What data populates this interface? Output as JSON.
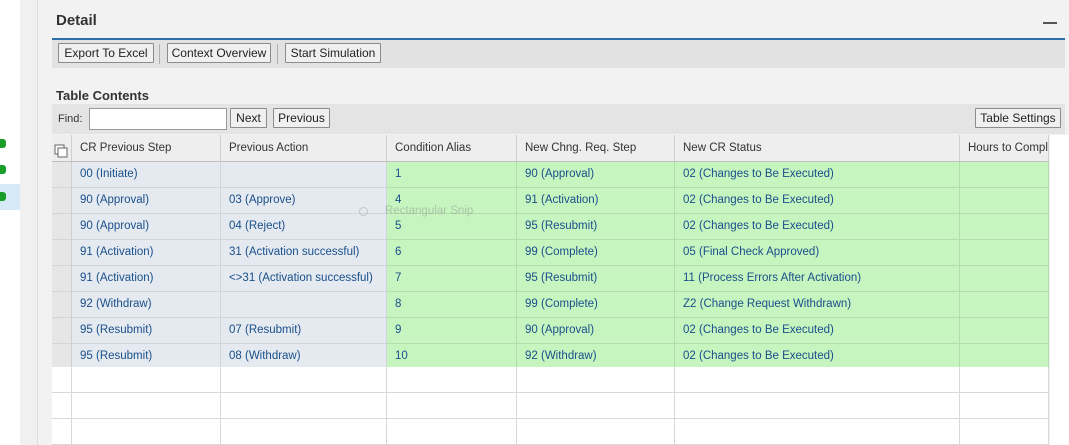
{
  "panel": {
    "title": "Detail"
  },
  "toolbar": {
    "export_label": "Export To Excel",
    "context_label": "Context Overview",
    "simulation_label": "Start Simulation"
  },
  "table_section": {
    "title": "Table Contents",
    "find_label": "Find:",
    "find_value": "",
    "next_label": "Next",
    "previous_label": "Previous",
    "settings_label": "Table Settings"
  },
  "overlay": {
    "snip_text": "Rectangular Snip"
  },
  "columns": [
    "CR Previous Step",
    "Previous Action",
    "Condition Alias",
    "New Chng. Req. Step",
    "New CR Status",
    "Hours to Compl"
  ],
  "rows": [
    [
      "00 (Initiate)",
      "",
      "1",
      "90 (Approval)",
      "02 (Changes to Be Executed)",
      ""
    ],
    [
      "90 (Approval)",
      "03 (Approve)",
      "4",
      "91 (Activation)",
      "02 (Changes to Be Executed)",
      ""
    ],
    [
      "90 (Approval)",
      "04 (Reject)",
      "5",
      "95 (Resubmit)",
      "02 (Changes to Be Executed)",
      ""
    ],
    [
      "91 (Activation)",
      "31 (Activation successful)",
      "6",
      "99 (Complete)",
      "05 (Final Check Approved)",
      ""
    ],
    [
      "91 (Activation)",
      "<>31 (Activation successful)",
      "7",
      "95 (Resubmit)",
      "11 (Process Errors After Activation)",
      ""
    ],
    [
      "92 (Withdraw)",
      "",
      "8",
      "99 (Complete)",
      "Z2 (Change Request Withdrawn)",
      ""
    ],
    [
      "95 (Resubmit)",
      "07 (Resubmit)",
      "9",
      "90 (Approval)",
      "02 (Changes to Be Executed)",
      ""
    ],
    [
      "95 (Resubmit)",
      "08 (Withdraw)",
      "10",
      "92 (Withdraw)",
      "02 (Changes to Be Executed)",
      ""
    ]
  ],
  "empty_row_count": 3,
  "colors": {
    "key_cell": "#e4eaf0",
    "result_cell": "#c6f5c0",
    "accent": "#2f6da8",
    "status_dot": "#1a9e2a"
  },
  "icons": [
    "minimize-icon",
    "select-all-icon",
    "status-dot-icon"
  ]
}
